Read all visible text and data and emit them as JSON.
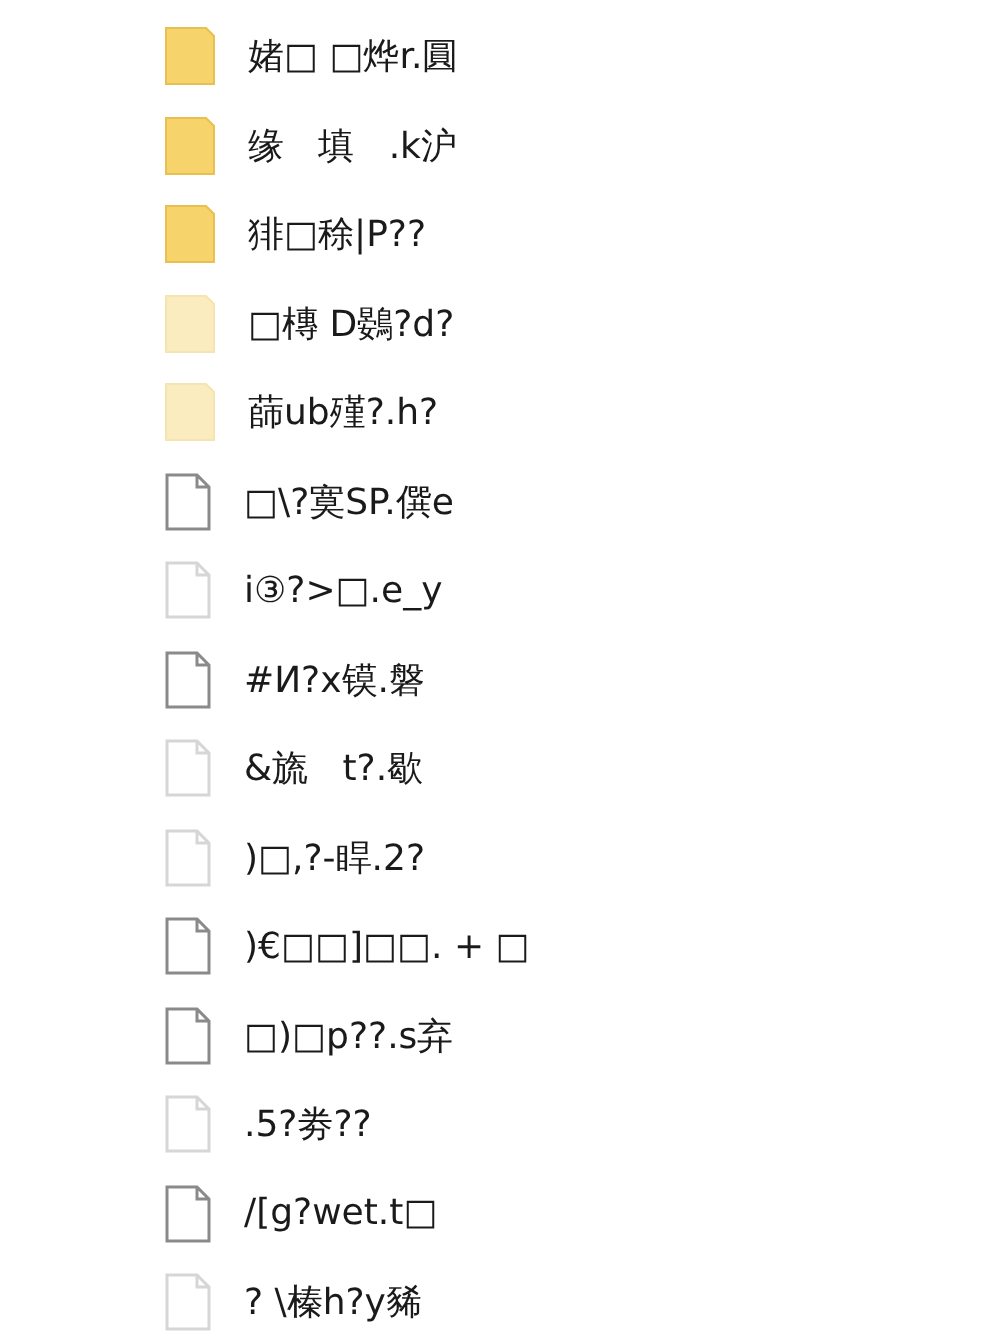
{
  "items": [
    {
      "kind": "folder",
      "name": "媎□ □烨r.圓",
      "hidden": false
    },
    {
      "kind": "folder",
      "name": "缘   填   .k沪",
      "hidden": false
    },
    {
      "kind": "folder",
      "name": "猅□稌|P??",
      "hidden": false
    },
    {
      "kind": "folder",
      "name": "□槫 D鷃?d?",
      "hidden": true
    },
    {
      "kind": "folder",
      "name": "蒒ub殣?.h?",
      "hidden": true
    },
    {
      "kind": "file",
      "name": "□\\?寞SP.僎e",
      "hidden": false
    },
    {
      "kind": "file",
      "name": "i③?>□.e_y",
      "hidden": true
    },
    {
      "kind": "file",
      "name": "#И?x镆.磐",
      "hidden": false
    },
    {
      "kind": "file",
      "name": "&旒   t?.歇",
      "hidden": true
    },
    {
      "kind": "file",
      "name": ")□,?-睅.2?",
      "hidden": true
    },
    {
      "kind": "file",
      "name": ")€□□]□□. + □",
      "hidden": false
    },
    {
      "kind": "file",
      "name": "□)□p??.s弃",
      "hidden": false
    },
    {
      "kind": "file",
      "name": ".5?劵??",
      "hidden": true
    },
    {
      "kind": "file",
      "name": "/[g?wet.t□",
      "hidden": false
    },
    {
      "kind": "file",
      "name": "? \\榛h?y豨",
      "hidden": true
    }
  ]
}
